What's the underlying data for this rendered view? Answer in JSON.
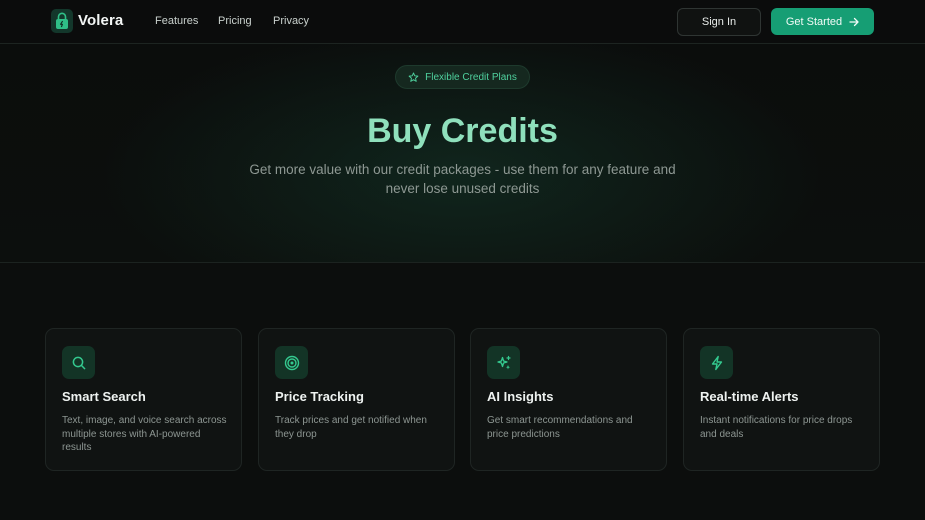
{
  "brand": {
    "name": "Volera"
  },
  "nav": {
    "links": [
      "Features",
      "Pricing",
      "Privacy"
    ],
    "sign_in": "Sign In",
    "get_started": "Get Started"
  },
  "hero": {
    "badge": "Flexible Credit Plans",
    "title": "Buy Credits",
    "subtitle": "Get more value with our credit packages - use them for any feature and never lose unused credits"
  },
  "features": [
    {
      "icon": "search-icon",
      "title": "Smart Search",
      "description": "Text, image, and voice search across multiple stores with AI-powered results"
    },
    {
      "icon": "target-icon",
      "title": "Price Tracking",
      "description": "Track prices and get notified when they drop"
    },
    {
      "icon": "sparkles-icon",
      "title": "AI Insights",
      "description": "Get smart recommendations and price predictions"
    },
    {
      "icon": "lightning-icon",
      "title": "Real-time Alerts",
      "description": "Instant notifications for price drops and deals"
    }
  ],
  "colors": {
    "accent": "#169e74",
    "heading": "#8fe0bc",
    "background": "#0c0e0d"
  }
}
